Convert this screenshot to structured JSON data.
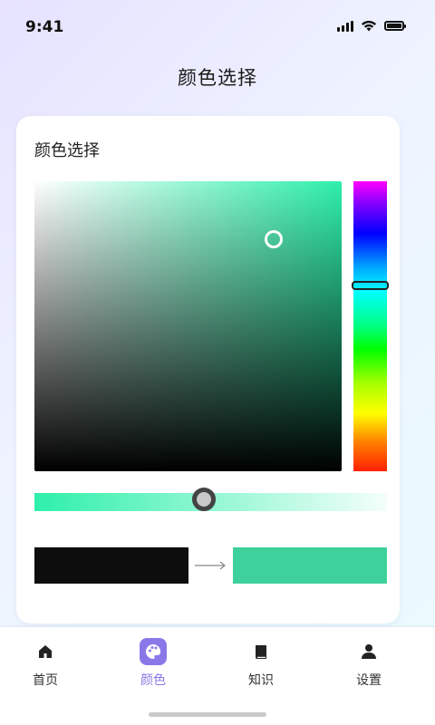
{
  "status_bar": {
    "time": "9:41"
  },
  "header": {
    "title": "颜色选择"
  },
  "card": {
    "title": "颜色选择",
    "hue_color": "#2ef0aa",
    "hue_fraction": 0.36,
    "saturation_fraction": 0.78,
    "brightness_fraction": 0.8,
    "alpha_fraction": 0.48,
    "old_color": "#0d0d0d",
    "new_color": "#3fd19b"
  },
  "nav": {
    "active_color": "#8b78e8",
    "items": [
      {
        "label": "首页",
        "icon": "home-icon",
        "active": false
      },
      {
        "label": "颜色",
        "icon": "palette-icon",
        "active": true
      },
      {
        "label": "知识",
        "icon": "book-icon",
        "active": false
      },
      {
        "label": "设置",
        "icon": "user-icon",
        "active": false
      }
    ]
  }
}
